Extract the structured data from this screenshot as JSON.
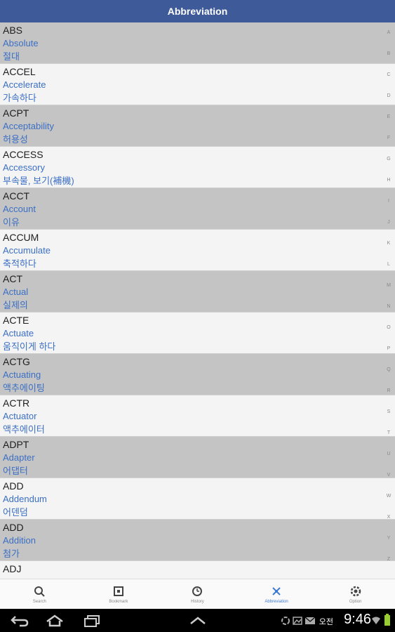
{
  "header": {
    "title": "Abbreviation"
  },
  "entries": [
    {
      "abbr": "ABS",
      "english": "Absolute",
      "korean": "절대"
    },
    {
      "abbr": "ACCEL",
      "english": "Accelerate",
      "korean": "가속하다"
    },
    {
      "abbr": "ACPT",
      "english": "Acceptability",
      "korean": "허용성"
    },
    {
      "abbr": "ACCESS",
      "english": "Accessory",
      "korean": "부속물, 보기(補機)"
    },
    {
      "abbr": "ACCT",
      "english": "Account",
      "korean": "이유"
    },
    {
      "abbr": "ACCUM",
      "english": "Accumulate",
      "korean": "축적하다"
    },
    {
      "abbr": "ACT",
      "english": "Actual",
      "korean": "실제의"
    },
    {
      "abbr": "ACTE",
      "english": "Actuate",
      "korean": "움직이게 하다"
    },
    {
      "abbr": "ACTG",
      "english": "Actuating",
      "korean": "액추에이팅"
    },
    {
      "abbr": "ACTR",
      "english": "Actuator",
      "korean": "액추에이터"
    },
    {
      "abbr": "ADPT",
      "english": "Adapter",
      "korean": "어댑터"
    },
    {
      "abbr": "ADD",
      "english": "Addendum",
      "korean": "어덴덤"
    },
    {
      "abbr": "ADD",
      "english": "Addition",
      "korean": "첨가"
    },
    {
      "abbr": "ADJ",
      "english": "",
      "korean": ""
    }
  ],
  "index_letters": [
    "A",
    "B",
    "C",
    "D",
    "E",
    "F",
    "G",
    "H",
    "I",
    "J",
    "K",
    "L",
    "M",
    "N",
    "O",
    "P",
    "Q",
    "R",
    "S",
    "T",
    "U",
    "V",
    "W",
    "X",
    "Y",
    "Z"
  ],
  "tabs": [
    {
      "label": "Search",
      "icon": "search-icon"
    },
    {
      "label": "Bookmark",
      "icon": "bookmark-icon"
    },
    {
      "label": "History",
      "icon": "clock-icon"
    },
    {
      "label": "Abbreviation",
      "icon": "abbreviation-icon",
      "active": true
    },
    {
      "label": "Option",
      "icon": "gear-icon"
    }
  ],
  "status": {
    "ampm": "오전",
    "time": "9:46"
  },
  "colors": {
    "header": "#3e5a99",
    "accent": "#3b6fc4",
    "active_tab": "#3e7bd6"
  }
}
